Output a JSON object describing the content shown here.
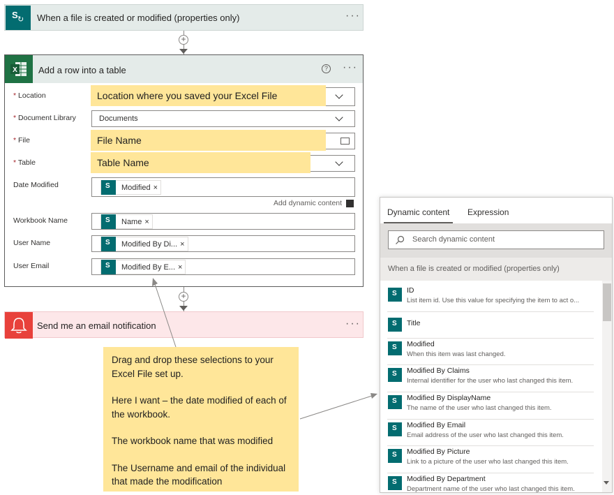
{
  "trigger": {
    "title": "When a file is created or modified (properties only)",
    "menu": "···"
  },
  "connector": {
    "plus": "+"
  },
  "excel_card": {
    "title": "Add a row into a table",
    "help": "?",
    "menu": "···",
    "fields": {
      "location": {
        "label": "Location",
        "value": "Location where you saved your Excel File"
      },
      "library": {
        "label": "Document Library",
        "value": "Documents"
      },
      "file": {
        "label": "File",
        "value": "File Name"
      },
      "table": {
        "label": "Table",
        "value": "Table Name"
      },
      "date_modified": {
        "label": "Date Modified",
        "token": "Modified"
      },
      "workbook_name": {
        "label": "Workbook Name",
        "token": "Name"
      },
      "user_name": {
        "label": "User Name",
        "token": "Modified By Di..."
      },
      "user_email": {
        "label": "User Email",
        "token": "Modified By E..."
      }
    },
    "required_mark": "*",
    "token_remove": "×",
    "add_dynamic": "Add dynamic content"
  },
  "email_card": {
    "title": "Send me an email notification",
    "menu": "···"
  },
  "note": {
    "p1": "Drag and drop these selections to your Excel File set up.",
    "p2": "Here I want – the date modified of each of the workbook.",
    "p3": "The workbook name that was modified",
    "p4": "The Username and email of the individual that made the modification"
  },
  "panel": {
    "tabs": [
      "Dynamic content",
      "Expression"
    ],
    "search_placeholder": "Search dynamic content",
    "group": "When a file is created or modified (properties only)",
    "items": [
      {
        "title": "ID",
        "desc": "List item id. Use this value for specifying the item to act o..."
      },
      {
        "title": "Title",
        "desc": ""
      },
      {
        "title": "Modified",
        "desc": "When this item was last changed."
      },
      {
        "title": "Modified By Claims",
        "desc": "Internal identifier for the user who last changed this item."
      },
      {
        "title": "Modified By DisplayName",
        "desc": "The name of the user who last changed this item."
      },
      {
        "title": "Modified By Email",
        "desc": "Email address of the user who last changed this item."
      },
      {
        "title": "Modified By Picture",
        "desc": "Link to a picture of the user who last changed this item."
      },
      {
        "title": "Modified By Department",
        "desc": "Department name of the user who last changed this item."
      }
    ]
  },
  "colors": {
    "sharepoint": "#036c70",
    "excel": "#1f7244",
    "email": "#e8413b",
    "highlight": "#ffe699"
  },
  "icons": [
    "sharepoint-icon",
    "excel-icon",
    "bell-icon",
    "search-icon",
    "folder-icon",
    "chevron-down-icon",
    "help-icon"
  ]
}
